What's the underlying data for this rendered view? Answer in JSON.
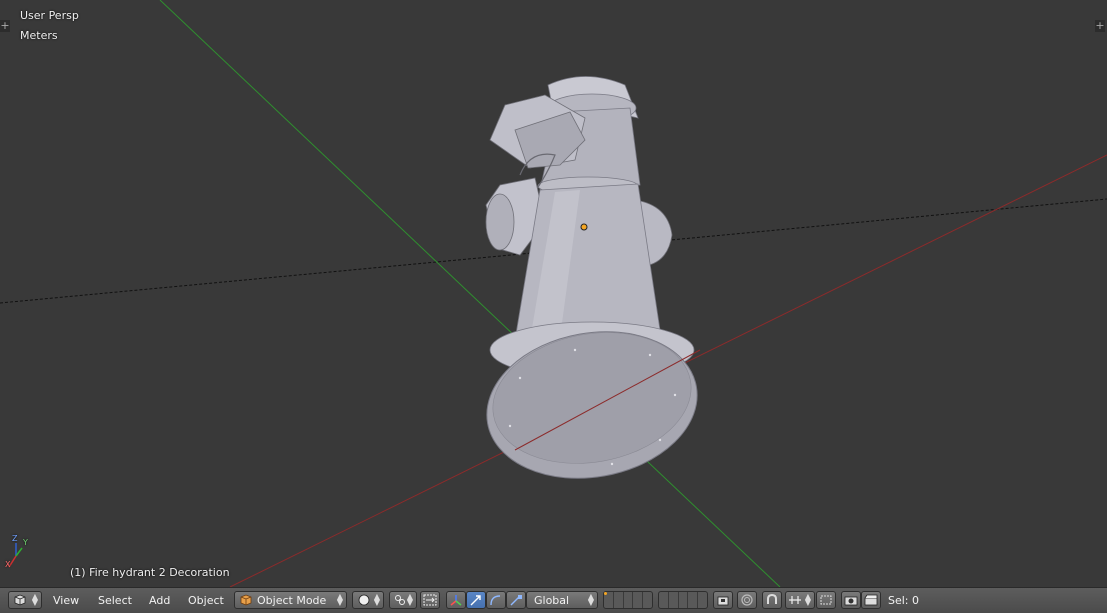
{
  "viewport": {
    "view_label": "User Persp",
    "units_label": "Meters",
    "object_label": "(1) Fire hydrant 2 Decoration",
    "axis_labels": {
      "x": "X",
      "y": "Y",
      "z": "Z"
    },
    "colors": {
      "background": "#393939",
      "x_axis": "#8c2b2b",
      "y_axis": "#2f8f2f",
      "origin": "#f5a623",
      "model": "#b8b8c2"
    }
  },
  "header": {
    "editor_type_icon": "view3d-icon",
    "menus": [
      "View",
      "Select",
      "Add",
      "Object"
    ],
    "mode": {
      "label": "Object Mode",
      "icon": "cube-icon"
    },
    "shading_icon": "solid-sphere-icon",
    "pivot_icon": "pivot-icon",
    "manipulator_icons": [
      "manipulator-axes-icon",
      "translate-icon",
      "rotate-icon",
      "scale-icon"
    ],
    "orientation": "Global",
    "layers_icon": "layers-grid-icon",
    "lock_icon": "camera-lock-icon",
    "proportional_icon": "proportional-edit-icon",
    "snap_icon": "snap-magnet-icon",
    "snap_target_icon": "snap-target-icon",
    "render_icons": [
      "opengl-render-icon",
      "opengl-anim-icon"
    ],
    "sel_text": "Sel: 0"
  }
}
